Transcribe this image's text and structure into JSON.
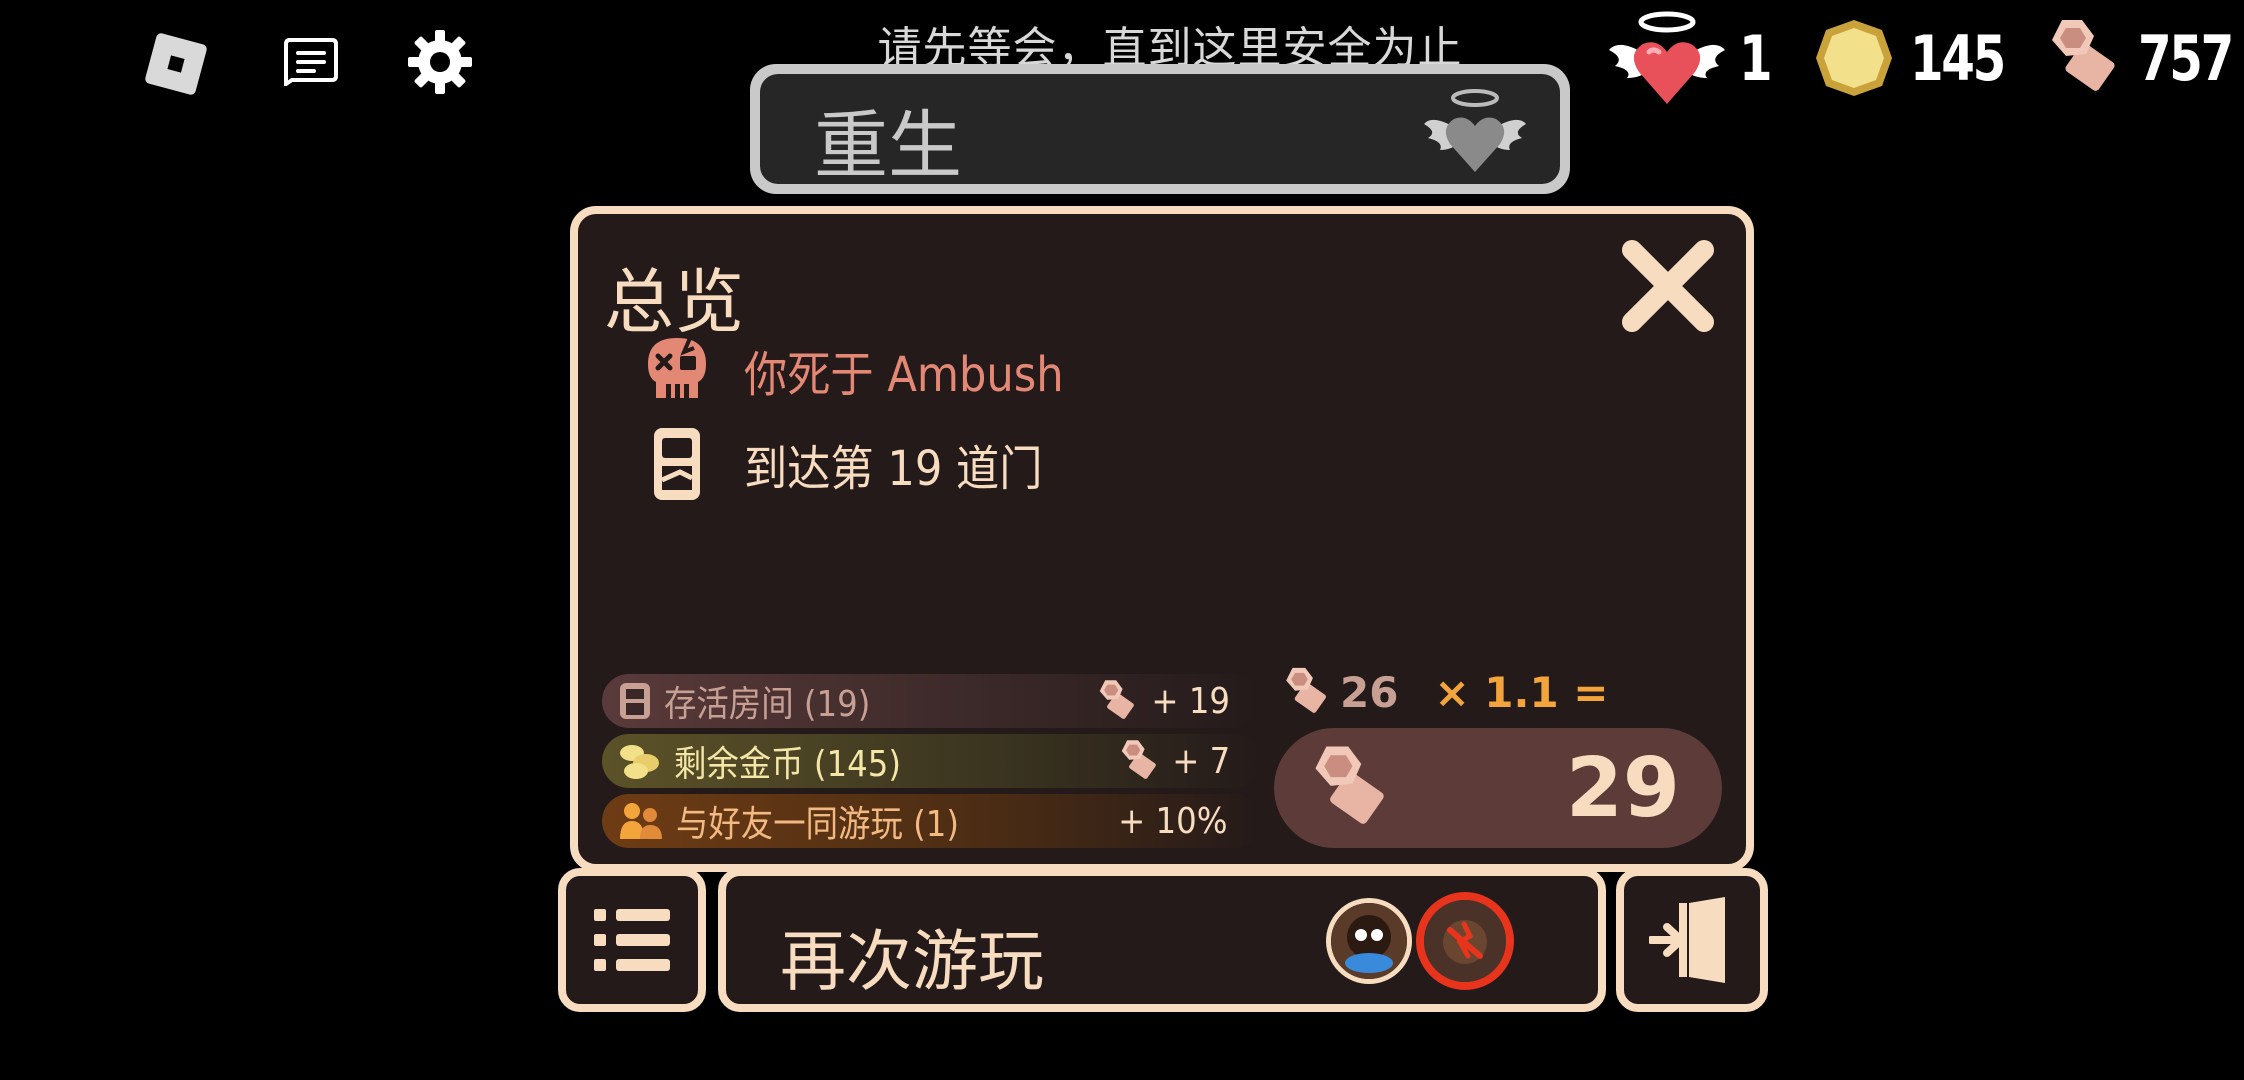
{
  "topbar": {
    "icons": [
      "roblox-logo-icon",
      "chat-icon",
      "gear-icon"
    ],
    "notice": "请先等会，直到这里安全为止"
  },
  "counters": {
    "lives": "1",
    "gold": "145",
    "knobs": "757"
  },
  "revive": {
    "label": "重生"
  },
  "overview": {
    "title": "总览",
    "death_text": "你死于 Ambush",
    "door_text": "到达第 19 道门"
  },
  "bonuses": [
    {
      "label": "存活房间 (19)",
      "value": "+ 19"
    },
    {
      "label": "剩余金币 (145)",
      "value": "+ 7"
    },
    {
      "label": "与好友一同游玩 (1)",
      "value": "+ 10%"
    }
  ],
  "formula": {
    "base": "26",
    "multiplier": "× 1.1 =",
    "total": "29"
  },
  "buttons": {
    "play_again": "再次游玩"
  },
  "colors": {
    "panel_bg": "#241a1a",
    "panel_border": "#f7dcc0",
    "death_red": "#e48876",
    "multiplier_orange": "#f3a53c",
    "avatar_ring_red": "#e8341c"
  }
}
